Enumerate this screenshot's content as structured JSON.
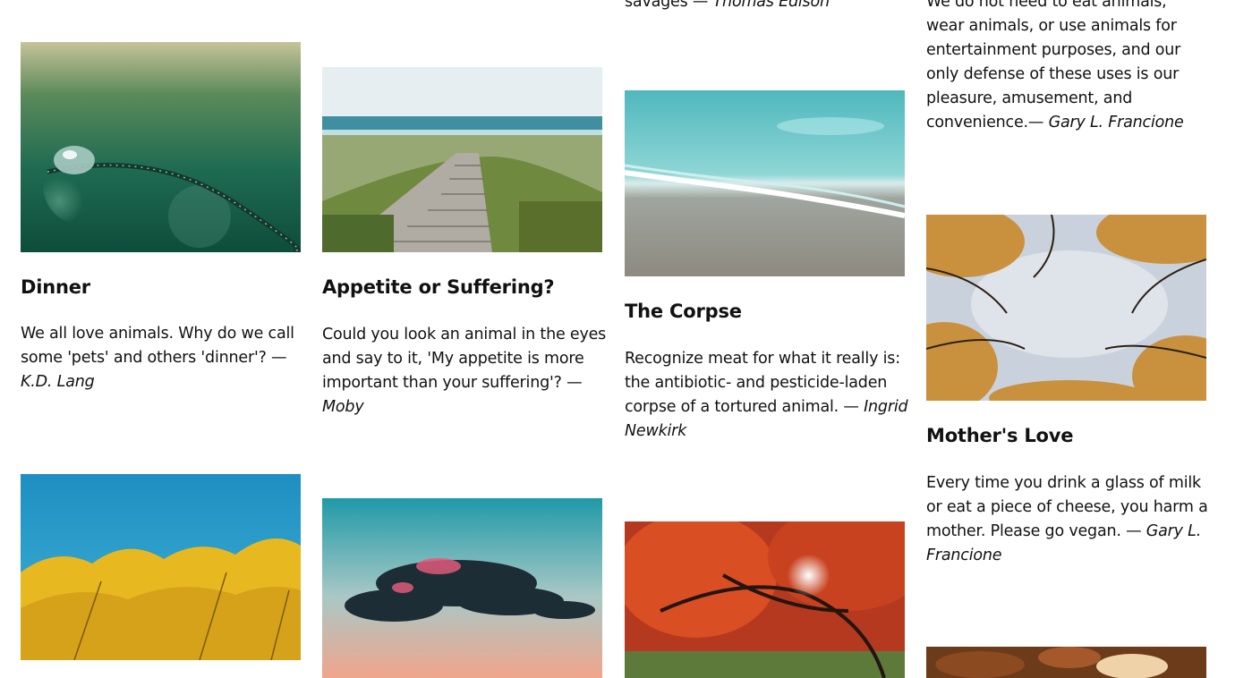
{
  "cards": [
    {
      "title": "Dinner",
      "quote": "We all love animals. Why do we call some 'pets' and others 'dinner'? —",
      "author": "K.D. Lang",
      "image_icon": "dewdrop-on-grass-photo"
    },
    {
      "title": "Appetite or Suffering?",
      "quote": "Could you look an animal in the eyes and say to it, 'My appetite is more important than your suffering'? —",
      "author": "Moby",
      "image_icon": "boardwalk-to-beach-photo"
    },
    {
      "title": "The Corpse",
      "quote": "Recognize meat for what it really is: the antibiotic- and pesticide-laden corpse of a tortured animal. —",
      "author": "Ingrid Newkirk",
      "image_icon": "ocean-wave-on-sand-photo"
    },
    {
      "title": "Mother's Love",
      "quote": "Every time you drink a glass of milk or eat a piece of cheese, you harm a mother. Please go vegan. —",
      "author": "Gary L. Francione",
      "image_icon": "autumn-trees-sky-photo"
    }
  ],
  "partial_top": {
    "col3_text": "savages —",
    "col3_author": "Thomas Edison",
    "col4_text": "We do not need to eat animals, wear animals, or use animals for entertainment purposes, and our only defense of these uses is our pleasure, amusement, and convenience.—",
    "col4_author": "Gary L. Francione"
  },
  "bottom_images": [
    "yellow-leaves-blue-sky-photo",
    "dark-cloud-sunset-photo",
    "red-autumn-tree-sunburst-photo",
    "fallen-autumn-leaves-photo"
  ]
}
